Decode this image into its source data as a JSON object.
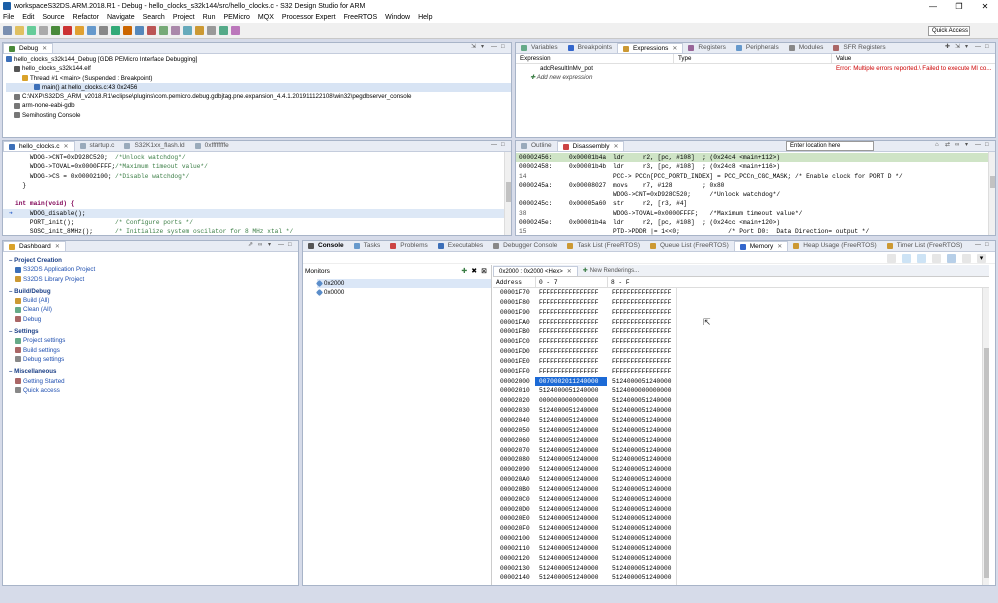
{
  "window": {
    "title": "workspaceS32DS.ARM.2018.R1 - Debug - hello_clocks_s32k144/src/hello_clocks.c - S32 Design Studio for ARM",
    "min": "—",
    "max": "❐",
    "close": "✕"
  },
  "menu": [
    "File",
    "Edit",
    "Source",
    "Refactor",
    "Navigate",
    "Search",
    "Project",
    "Run",
    "PEMicro",
    "MQX",
    "Processor Expert",
    "FreeRTOS",
    "Window",
    "Help"
  ],
  "toolbar": {
    "quick_access": "Quick Access"
  },
  "debug_view": {
    "tab": "Debug",
    "rows": [
      "hello_clocks_s32k144_Debug [GDB PEMicro Interface Debugging]",
      "hello_clocks_s32k144.elf",
      "Thread #1 <main> (Suspended : Breakpoint)",
      "main() at hello_clocks.c:43 0x2456",
      "C:\\NXP\\S32DS_ARM_v2018.R1\\eclipse\\plugins\\com.pemicro.debug.gdbjtag.pne.expansion_4.4.1.201911122108\\win32\\pegdbserver_console",
      "arm-none-eabi-gdb",
      "Semihosting Console"
    ]
  },
  "expressions_view": {
    "tabs": [
      "Variables",
      "Breakpoints",
      "Expressions",
      "Registers",
      "Peripherals",
      "Modules",
      "SFR Registers"
    ],
    "headers": [
      "Expression",
      "Type",
      "Value"
    ],
    "rows": [
      {
        "expr": "adcResultInMv_pot",
        "type": "",
        "value": "Error: Multiple errors reported.\\ Failed to execute MI co..."
      }
    ],
    "add": "Add new expression"
  },
  "editor": {
    "tabs": [
      "hello_clocks.c",
      "startup.c",
      "S32K1xx_flash.ld",
      "0xffffffffe"
    ],
    "lines": [
      {
        "code": "    WDOG->CNT=0xD928C520;",
        "cmt": "/*Unlock watchdog*/"
      },
      {
        "code": "    WDOG->TOVAL=0x0000FFFF;",
        "cmt": "/*Maximum timeout value*/"
      },
      {
        "code": "    WDOG->CS = 0x00002100;",
        "cmt": "/*Disable watchdog*/"
      },
      {
        "code": "  }",
        "cmt": ""
      },
      {
        "code": "",
        "cmt": ""
      },
      {
        "code": "int main(void) {",
        "cmt": ""
      },
      {
        "code": "    WDOG_disable();",
        "cmt": ""
      },
      {
        "code": "    PORT_init();",
        "cmt": "/* Configure ports */"
      },
      {
        "code": "    SOSC_init_8MHz();",
        "cmt": "/* Initialize system oscilator for 8 MHz xtal */"
      }
    ]
  },
  "disassembly": {
    "tabs": [
      "Outline",
      "Disassembly"
    ],
    "location_placeholder": "Enter location here",
    "rows": [
      {
        "a": "00002456:",
        "b": "0x00001b4a",
        "c": "ldr     r2, [pc, #108]  ; (0x24c4 <main+112>)",
        "hl": true
      },
      {
        "a": "00002458:",
        "b": "0x00001b4b",
        "c": "ldr     r3, [pc, #108]  ; (0x24c8 <main+116>)",
        "hl": false
      },
      {
        "a": "14",
        "b": "",
        "c": "PCC-> PCCn[PCC_PORTD_INDEX] = PCC_PCCn_CGC_MASK; /* Enable clock for PORT D */",
        "hl": false
      },
      {
        "a": "0000245a:",
        "b": "0x00008027",
        "c": "movs    r7, #128        ; 0x80",
        "hl": false
      },
      {
        "a": "",
        "b": "",
        "c": "WDOG->CNT=0xD928C520;     /*Unlock watchdog*/",
        "hl": false
      },
      {
        "a": "0000245c:",
        "b": "0x00005a60",
        "c": "str     r2, [r3, #4]",
        "hl": false
      },
      {
        "a": "38",
        "b": "",
        "c": "WDOG->TOVAL=0x0000FFFF;   /*Maximum timeout value*/",
        "hl": false
      },
      {
        "a": "0000245e:",
        "b": "0x00001b4a",
        "c": "ldr     r2, [pc, #108]  ; (0x24cc <main+120>)",
        "hl": false
      },
      {
        "a": "15",
        "b": "",
        "c": "PTD->PDDR |= 1<<0;             /* Port D0:  Data Direction= output */",
        "hl": false
      }
    ]
  },
  "dashboard": {
    "tab": "Dashboard",
    "sections": [
      {
        "title": "Project Creation",
        "items": [
          "S32DS Application Project",
          "S32DS Library Project"
        ]
      },
      {
        "title": "Build/Debug",
        "items": [
          "Build  (All)",
          "Clean  (All)",
          "Debug"
        ]
      },
      {
        "title": "Settings",
        "items": [
          "Project settings",
          "Build settings",
          "Debug settings"
        ]
      },
      {
        "title": "Miscellaneous",
        "items": [
          "Getting Started",
          "Quick access"
        ]
      }
    ]
  },
  "bottom_tabs": [
    "Console",
    "Tasks",
    "Problems",
    "Executables",
    "Debugger Console",
    "Task List (FreeRTOS)",
    "Queue List (FreeRTOS)",
    "Memory",
    "Heap Usage (FreeRTOS)",
    "Timer List (FreeRTOS)"
  ],
  "memory": {
    "monitors_label": "Monitors",
    "monitors": [
      "0x2000",
      "0x0000"
    ],
    "rendering_tab": "0x2000 : 0x2000 <Hex>",
    "new_rendering": "New Renderings...",
    "headers": [
      "Address",
      "0 - 7",
      "8 - F"
    ],
    "rows": [
      [
        "00001F70",
        "FFFFFFFFFFFFFFFF",
        "FFFFFFFFFFFFFFFF"
      ],
      [
        "00001F80",
        "FFFFFFFFFFFFFFFF",
        "FFFFFFFFFFFFFFFF"
      ],
      [
        "00001F90",
        "FFFFFFFFFFFFFFFF",
        "FFFFFFFFFFFFFFFF"
      ],
      [
        "00001FA0",
        "FFFFFFFFFFFFFFFF",
        "FFFFFFFFFFFFFFFF"
      ],
      [
        "00001FB0",
        "FFFFFFFFFFFFFFFF",
        "FFFFFFFFFFFFFFFF"
      ],
      [
        "00001FC0",
        "FFFFFFFFFFFFFFFF",
        "FFFFFFFFFFFFFFFF"
      ],
      [
        "00001FD0",
        "FFFFFFFFFFFFFFFF",
        "FFFFFFFFFFFFFFFF"
      ],
      [
        "00001FE0",
        "FFFFFFFFFFFFFFFF",
        "FFFFFFFFFFFFFFFF"
      ],
      [
        "00001FF0",
        "FFFFFFFFFFFFFFFF",
        "FFFFFFFFFFFFFFFF"
      ],
      [
        "00002000",
        "0070002011240000",
        "5124000051240000"
      ],
      [
        "00002010",
        "5124000051240000",
        "5124000000000000"
      ],
      [
        "00002020",
        "0000000000000000",
        "5124000051240000"
      ],
      [
        "00002030",
        "5124000051240000",
        "5124000051240000"
      ],
      [
        "00002040",
        "5124000051240000",
        "5124000051240000"
      ],
      [
        "00002050",
        "5124000051240000",
        "5124000051240000"
      ],
      [
        "00002060",
        "5124000051240000",
        "5124000051240000"
      ],
      [
        "00002070",
        "5124000051240000",
        "5124000051240000"
      ],
      [
        "00002080",
        "5124000051240000",
        "5124000051240000"
      ],
      [
        "00002090",
        "5124000051240000",
        "5124000051240000"
      ],
      [
        "000020A0",
        "5124000051240000",
        "5124000051240000"
      ],
      [
        "000020B0",
        "5124000051240000",
        "5124000051240000"
      ],
      [
        "000020C0",
        "5124000051240000",
        "5124000051240000"
      ],
      [
        "000020D0",
        "5124000051240000",
        "5124000051240000"
      ],
      [
        "000020E0",
        "5124000051240000",
        "5124000051240000"
      ],
      [
        "000020F0",
        "5124000051240000",
        "5124000051240000"
      ],
      [
        "00002100",
        "5124000051240000",
        "5124000051240000"
      ],
      [
        "00002110",
        "5124000051240000",
        "5124000051240000"
      ],
      [
        "00002120",
        "5124000051240000",
        "5124000051240000"
      ],
      [
        "00002130",
        "5124000051240000",
        "5124000051240000"
      ],
      [
        "00002140",
        "5124000051240000",
        "5124000051240000"
      ]
    ]
  }
}
